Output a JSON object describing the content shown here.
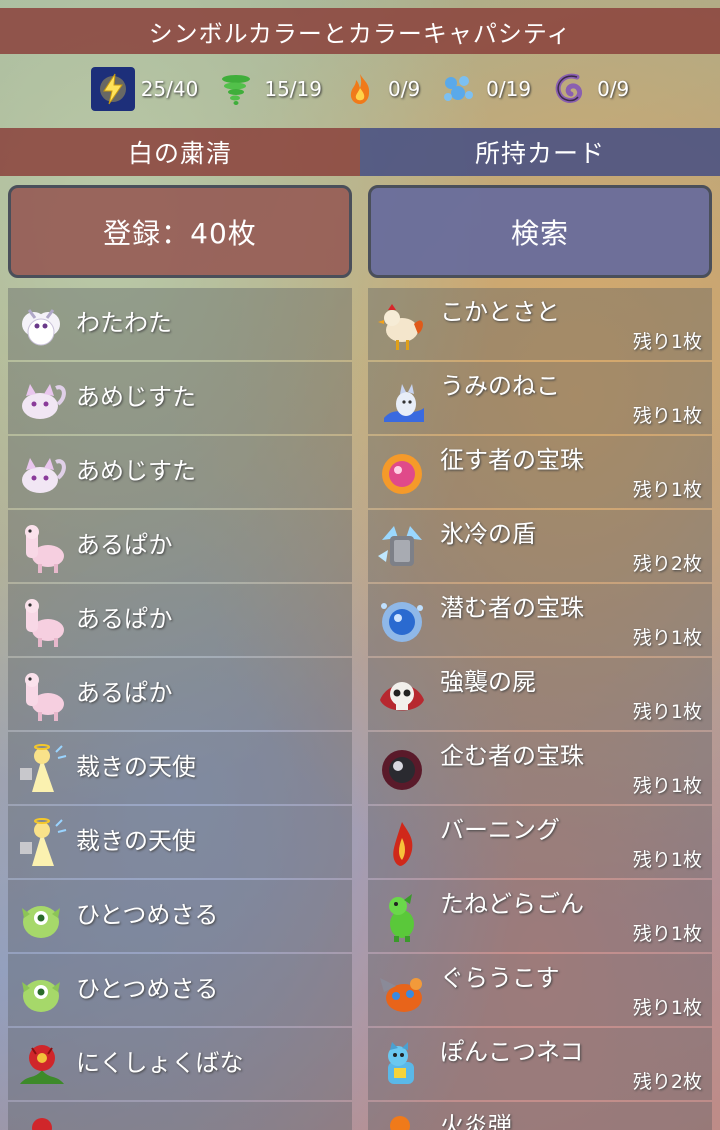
{
  "title": "シンボルカラーとカラーキャパシティ",
  "capacities": [
    {
      "icon": "lightning-icon",
      "value": "25/40",
      "color": "#f5d33b"
    },
    {
      "icon": "tornado-icon",
      "value": "15/19",
      "color": "#3fae3a"
    },
    {
      "icon": "flame-icon",
      "value": "0/9",
      "color": "#f07a1a"
    },
    {
      "icon": "water-bubbles-icon",
      "value": "0/19",
      "color": "#5aa9ea"
    },
    {
      "icon": "dark-swirl-icon",
      "value": "0/9",
      "color": "#8a5fb0"
    }
  ],
  "deck_header": "白の粛清",
  "collection_header": "所持カード",
  "register_button": "登録：40枚",
  "search_button": "検索",
  "deck": [
    {
      "name": "わたわた",
      "icon": "white-fluffy-monster-icon"
    },
    {
      "name": "あめじすた",
      "icon": "white-cat-icon"
    },
    {
      "name": "あめじすた",
      "icon": "white-cat-icon"
    },
    {
      "name": "あるぱか",
      "icon": "pink-alpaca-icon"
    },
    {
      "name": "あるぱか",
      "icon": "pink-alpaca-icon"
    },
    {
      "name": "あるぱか",
      "icon": "pink-alpaca-icon"
    },
    {
      "name": "裁きの天使",
      "icon": "angel-icon"
    },
    {
      "name": "裁きの天使",
      "icon": "angel-icon"
    },
    {
      "name": "ひとつめさる",
      "icon": "green-monkey-icon"
    },
    {
      "name": "ひとつめさる",
      "icon": "green-monkey-icon"
    },
    {
      "name": "にくしょくばな",
      "icon": "red-flower-plant-icon"
    }
  ],
  "collection": [
    {
      "name": "こかとさと",
      "count": "残り1枚",
      "icon": "rooster-icon"
    },
    {
      "name": "うみのねこ",
      "count": "残り1枚",
      "icon": "sea-cat-icon"
    },
    {
      "name": "征す者の宝珠",
      "count": "残り1枚",
      "icon": "pink-orb-icon"
    },
    {
      "name": "氷冷の盾",
      "count": "残り2枚",
      "icon": "ice-shield-icon"
    },
    {
      "name": "潜む者の宝珠",
      "count": "残り1枚",
      "icon": "blue-orb-icon"
    },
    {
      "name": "強襲の屍",
      "count": "残り1枚",
      "icon": "skull-icon"
    },
    {
      "name": "企む者の宝珠",
      "count": "残り1枚",
      "icon": "dark-orb-icon"
    },
    {
      "name": "バーニング",
      "count": "残り1枚",
      "icon": "fire-spirit-icon"
    },
    {
      "name": "たねどらごん",
      "count": "残り1枚",
      "icon": "green-dragon-icon"
    },
    {
      "name": "ぐらうこす",
      "count": "残り1枚",
      "icon": "orange-beast-icon"
    },
    {
      "name": "ぽんこつネコ",
      "count": "残り2枚",
      "icon": "robot-cat-icon"
    },
    {
      "name": "火炎弾",
      "count": "",
      "icon": "fireball-icon"
    }
  ]
}
